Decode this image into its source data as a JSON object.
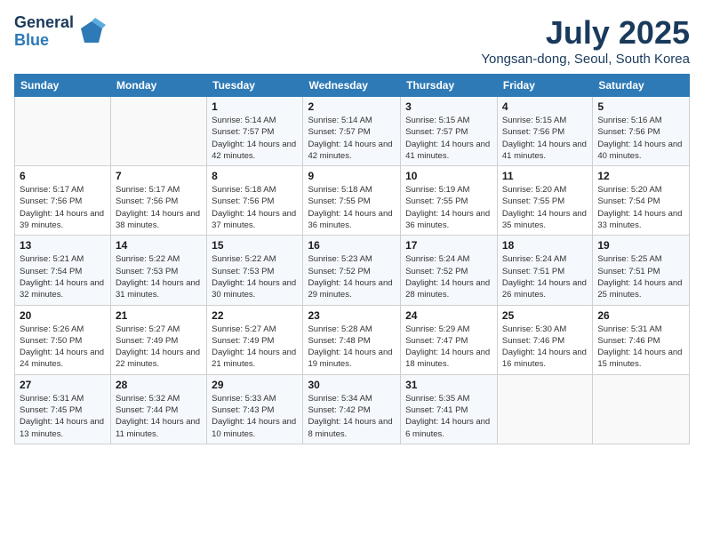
{
  "header": {
    "logo_general": "General",
    "logo_blue": "Blue",
    "month_title": "July 2025",
    "location": "Yongsan-dong, Seoul, South Korea"
  },
  "weekdays": [
    "Sunday",
    "Monday",
    "Tuesday",
    "Wednesday",
    "Thursday",
    "Friday",
    "Saturday"
  ],
  "weeks": [
    [
      {
        "day": "",
        "info": ""
      },
      {
        "day": "",
        "info": ""
      },
      {
        "day": "1",
        "sunrise": "Sunrise: 5:14 AM",
        "sunset": "Sunset: 7:57 PM",
        "daylight": "Daylight: 14 hours and 42 minutes."
      },
      {
        "day": "2",
        "sunrise": "Sunrise: 5:14 AM",
        "sunset": "Sunset: 7:57 PM",
        "daylight": "Daylight: 14 hours and 42 minutes."
      },
      {
        "day": "3",
        "sunrise": "Sunrise: 5:15 AM",
        "sunset": "Sunset: 7:57 PM",
        "daylight": "Daylight: 14 hours and 41 minutes."
      },
      {
        "day": "4",
        "sunrise": "Sunrise: 5:15 AM",
        "sunset": "Sunset: 7:56 PM",
        "daylight": "Daylight: 14 hours and 41 minutes."
      },
      {
        "day": "5",
        "sunrise": "Sunrise: 5:16 AM",
        "sunset": "Sunset: 7:56 PM",
        "daylight": "Daylight: 14 hours and 40 minutes."
      }
    ],
    [
      {
        "day": "6",
        "sunrise": "Sunrise: 5:17 AM",
        "sunset": "Sunset: 7:56 PM",
        "daylight": "Daylight: 14 hours and 39 minutes."
      },
      {
        "day": "7",
        "sunrise": "Sunrise: 5:17 AM",
        "sunset": "Sunset: 7:56 PM",
        "daylight": "Daylight: 14 hours and 38 minutes."
      },
      {
        "day": "8",
        "sunrise": "Sunrise: 5:18 AM",
        "sunset": "Sunset: 7:56 PM",
        "daylight": "Daylight: 14 hours and 37 minutes."
      },
      {
        "day": "9",
        "sunrise": "Sunrise: 5:18 AM",
        "sunset": "Sunset: 7:55 PM",
        "daylight": "Daylight: 14 hours and 36 minutes."
      },
      {
        "day": "10",
        "sunrise": "Sunrise: 5:19 AM",
        "sunset": "Sunset: 7:55 PM",
        "daylight": "Daylight: 14 hours and 36 minutes."
      },
      {
        "day": "11",
        "sunrise": "Sunrise: 5:20 AM",
        "sunset": "Sunset: 7:55 PM",
        "daylight": "Daylight: 14 hours and 35 minutes."
      },
      {
        "day": "12",
        "sunrise": "Sunrise: 5:20 AM",
        "sunset": "Sunset: 7:54 PM",
        "daylight": "Daylight: 14 hours and 33 minutes."
      }
    ],
    [
      {
        "day": "13",
        "sunrise": "Sunrise: 5:21 AM",
        "sunset": "Sunset: 7:54 PM",
        "daylight": "Daylight: 14 hours and 32 minutes."
      },
      {
        "day": "14",
        "sunrise": "Sunrise: 5:22 AM",
        "sunset": "Sunset: 7:53 PM",
        "daylight": "Daylight: 14 hours and 31 minutes."
      },
      {
        "day": "15",
        "sunrise": "Sunrise: 5:22 AM",
        "sunset": "Sunset: 7:53 PM",
        "daylight": "Daylight: 14 hours and 30 minutes."
      },
      {
        "day": "16",
        "sunrise": "Sunrise: 5:23 AM",
        "sunset": "Sunset: 7:52 PM",
        "daylight": "Daylight: 14 hours and 29 minutes."
      },
      {
        "day": "17",
        "sunrise": "Sunrise: 5:24 AM",
        "sunset": "Sunset: 7:52 PM",
        "daylight": "Daylight: 14 hours and 28 minutes."
      },
      {
        "day": "18",
        "sunrise": "Sunrise: 5:24 AM",
        "sunset": "Sunset: 7:51 PM",
        "daylight": "Daylight: 14 hours and 26 minutes."
      },
      {
        "day": "19",
        "sunrise": "Sunrise: 5:25 AM",
        "sunset": "Sunset: 7:51 PM",
        "daylight": "Daylight: 14 hours and 25 minutes."
      }
    ],
    [
      {
        "day": "20",
        "sunrise": "Sunrise: 5:26 AM",
        "sunset": "Sunset: 7:50 PM",
        "daylight": "Daylight: 14 hours and 24 minutes."
      },
      {
        "day": "21",
        "sunrise": "Sunrise: 5:27 AM",
        "sunset": "Sunset: 7:49 PM",
        "daylight": "Daylight: 14 hours and 22 minutes."
      },
      {
        "day": "22",
        "sunrise": "Sunrise: 5:27 AM",
        "sunset": "Sunset: 7:49 PM",
        "daylight": "Daylight: 14 hours and 21 minutes."
      },
      {
        "day": "23",
        "sunrise": "Sunrise: 5:28 AM",
        "sunset": "Sunset: 7:48 PM",
        "daylight": "Daylight: 14 hours and 19 minutes."
      },
      {
        "day": "24",
        "sunrise": "Sunrise: 5:29 AM",
        "sunset": "Sunset: 7:47 PM",
        "daylight": "Daylight: 14 hours and 18 minutes."
      },
      {
        "day": "25",
        "sunrise": "Sunrise: 5:30 AM",
        "sunset": "Sunset: 7:46 PM",
        "daylight": "Daylight: 14 hours and 16 minutes."
      },
      {
        "day": "26",
        "sunrise": "Sunrise: 5:31 AM",
        "sunset": "Sunset: 7:46 PM",
        "daylight": "Daylight: 14 hours and 15 minutes."
      }
    ],
    [
      {
        "day": "27",
        "sunrise": "Sunrise: 5:31 AM",
        "sunset": "Sunset: 7:45 PM",
        "daylight": "Daylight: 14 hours and 13 minutes."
      },
      {
        "day": "28",
        "sunrise": "Sunrise: 5:32 AM",
        "sunset": "Sunset: 7:44 PM",
        "daylight": "Daylight: 14 hours and 11 minutes."
      },
      {
        "day": "29",
        "sunrise": "Sunrise: 5:33 AM",
        "sunset": "Sunset: 7:43 PM",
        "daylight": "Daylight: 14 hours and 10 minutes."
      },
      {
        "day": "30",
        "sunrise": "Sunrise: 5:34 AM",
        "sunset": "Sunset: 7:42 PM",
        "daylight": "Daylight: 14 hours and 8 minutes."
      },
      {
        "day": "31",
        "sunrise": "Sunrise: 5:35 AM",
        "sunset": "Sunset: 7:41 PM",
        "daylight": "Daylight: 14 hours and 6 minutes."
      },
      {
        "day": "",
        "info": ""
      },
      {
        "day": "",
        "info": ""
      }
    ]
  ]
}
